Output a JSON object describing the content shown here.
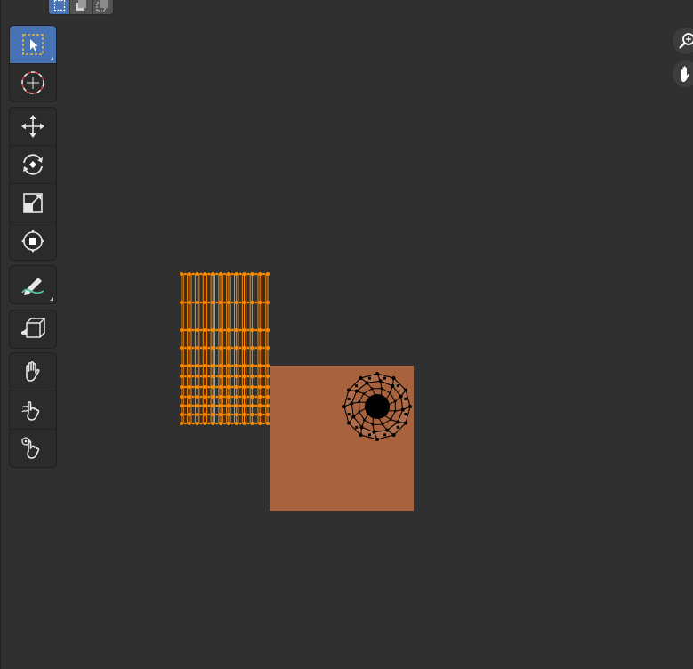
{
  "app": {
    "editor": "UV Editor"
  },
  "header": {
    "select_modes": [
      {
        "icon": "select-box-mode-icon",
        "active": true
      },
      {
        "icon": "select-extend-mode-icon",
        "active": false
      },
      {
        "icon": "select-subtract-mode-icon",
        "active": false
      }
    ]
  },
  "toolbar": {
    "groups": [
      [
        "select-box-icon",
        "cursor-icon"
      ],
      [
        "move-icon",
        "rotate-icon",
        "scale-icon",
        "transform-icon"
      ],
      [
        "annotate-icon"
      ],
      [
        "rip-region-icon"
      ],
      [
        "grab-brush-icon",
        "relax-brush-icon",
        "pinch-brush-icon"
      ]
    ],
    "active_tool": "select-box-icon"
  },
  "navigation": {
    "zoom": "zoom-icon",
    "pan": "pan-hand-icon"
  },
  "colors": {
    "background": "#303030",
    "active_tool": "#4772b3",
    "uv_selected": "#ff8c00",
    "image_fill": "#a8623d",
    "uv_unselected": "#000000"
  }
}
